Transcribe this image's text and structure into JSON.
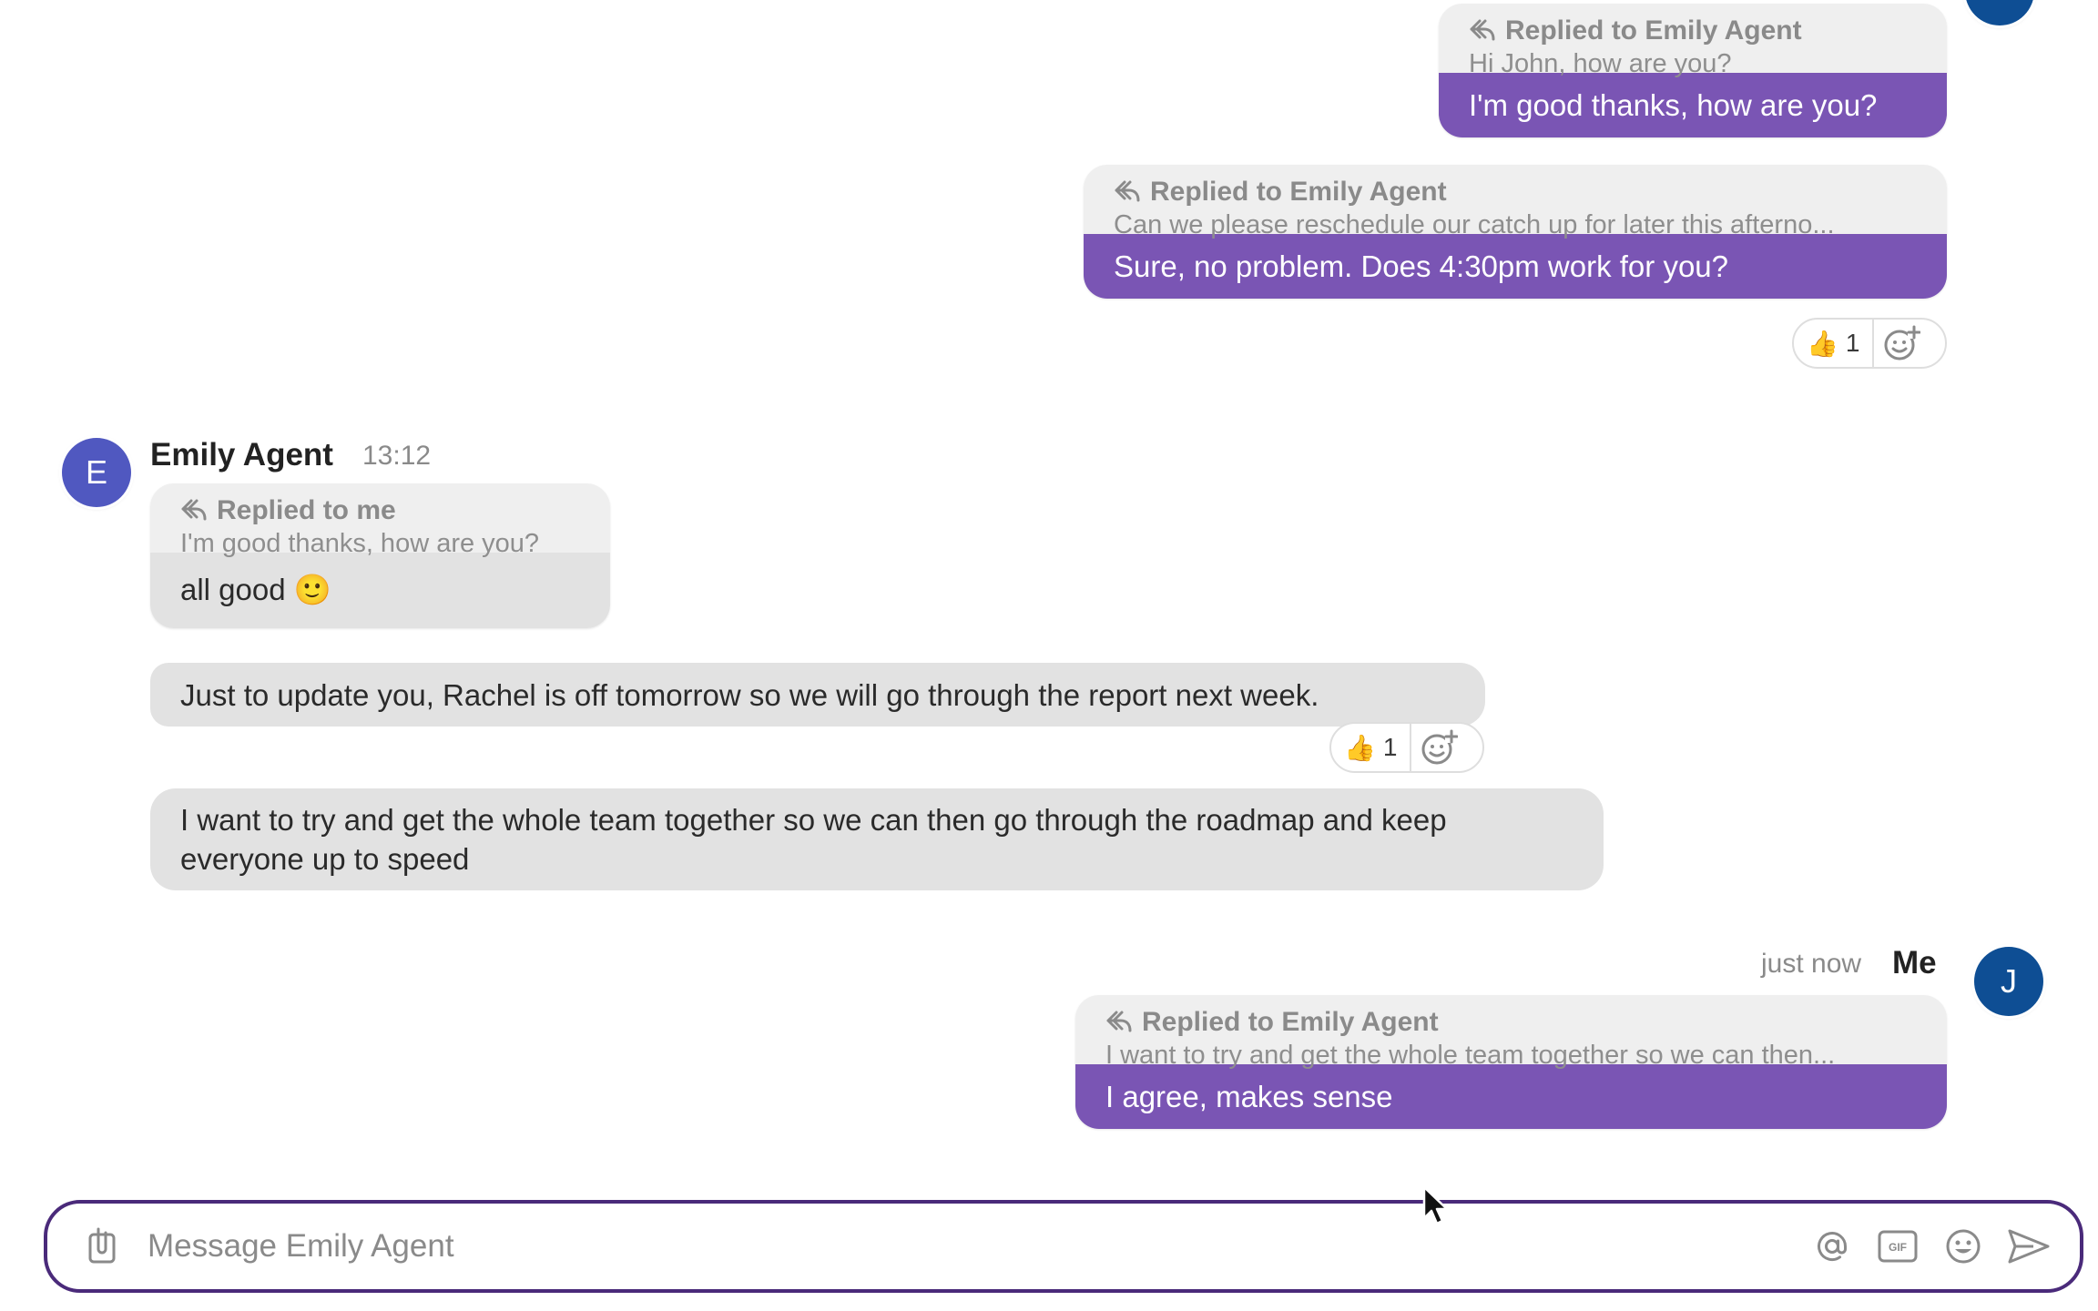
{
  "colors": {
    "accent_purple": "#7a55b4",
    "composer_border": "#4a2a7a",
    "avatar_emily": "#5058c0",
    "avatar_me": "#0e4e94",
    "bubble_grey": "#e2e2e2",
    "quote_grey": "#efefef"
  },
  "messages": {
    "m1": {
      "reply_label": "Replied to Emily Agent",
      "reply_text": "Hi John, how are you?",
      "text": "I'm good thanks, how are you?"
    },
    "m2": {
      "reply_label": "Replied to Emily Agent",
      "reply_text": "Can we please reschedule our catch up for later this afterno...",
      "text": "Sure, no problem. Does 4:30pm work for you?",
      "reaction_emoji": "👍",
      "reaction_count": "1"
    },
    "emily": {
      "avatar_letter": "E",
      "name": "Emily Agent",
      "time": "13:12",
      "m3": {
        "reply_label": "Replied to me",
        "reply_text": "I'm good thanks, how are you?",
        "text": "all good 🙂"
      },
      "m4": {
        "text": "Just to update you, Rachel is off tomorrow so we will go through the report next week.",
        "reaction_emoji": "👍",
        "reaction_count": "1"
      },
      "m5": {
        "text": "I want to try and get the whole team together so we can then go through the roadmap and keep everyone up to speed"
      }
    },
    "me": {
      "avatar_letter": "J",
      "name": "Me",
      "time": "just now",
      "m6": {
        "reply_label": "Replied to Emily Agent",
        "reply_text": "I want to try and get the whole team together so we can then...",
        "text": "I agree, makes sense"
      }
    }
  },
  "composer": {
    "placeholder": "Message Emily Agent",
    "value": "",
    "icons": [
      "attachment-icon",
      "mention-icon",
      "gif-icon",
      "emoji-icon",
      "send-icon"
    ]
  }
}
